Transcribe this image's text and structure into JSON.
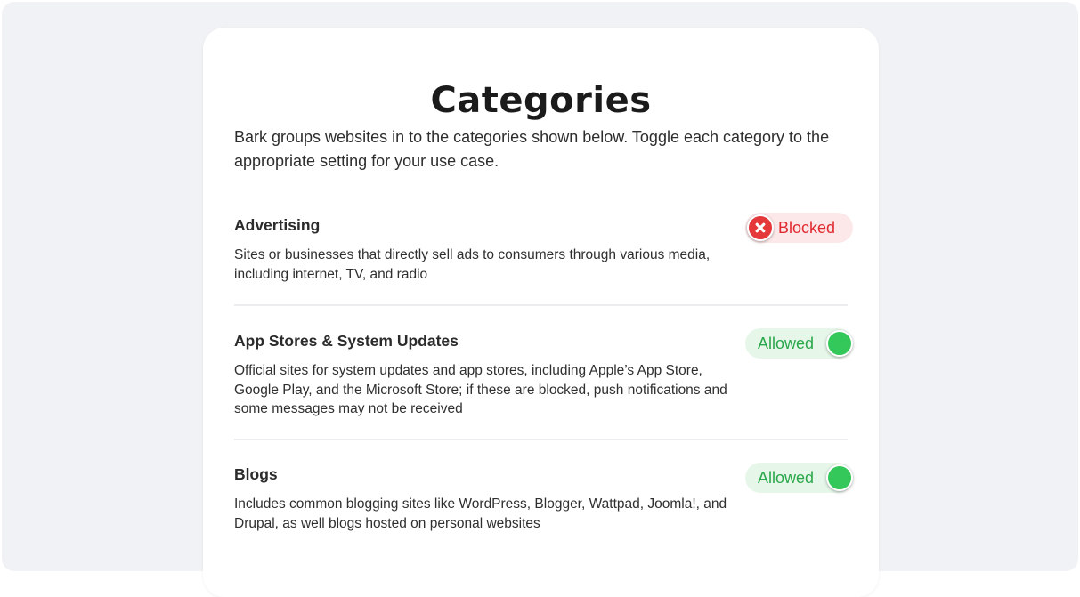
{
  "page": {
    "title": "Categories",
    "intro": "Bark groups websites in to the categories shown below. Toggle each category to the appropriate setting for your use case."
  },
  "categories": [
    {
      "name": "Advertising",
      "description": "Sites or businesses that directly sell ads to consumers through various media, including internet, TV, and radio",
      "status": "Blocked"
    },
    {
      "name": "App Stores & System Updates",
      "description": "Official sites for system updates and app stores, including Apple’s App Store, Google Play, and the Microsoft Store; if these are blocked, push notifications and some messages may not be received",
      "status": "Allowed"
    },
    {
      "name": "Blogs",
      "description": "Includes common blogging sites like WordPress, Blogger, Wattpad, Joomla!, and Drupal, as well blogs hosted on personal websites",
      "status": "Allowed"
    }
  ],
  "colors": {
    "blocked_accent": "#e5383b",
    "allowed_accent": "#34c759",
    "background": "#f1f2f5"
  },
  "icons": {
    "blocked_knob": "x-circle-icon",
    "allowed_knob": "toggle-knob"
  }
}
